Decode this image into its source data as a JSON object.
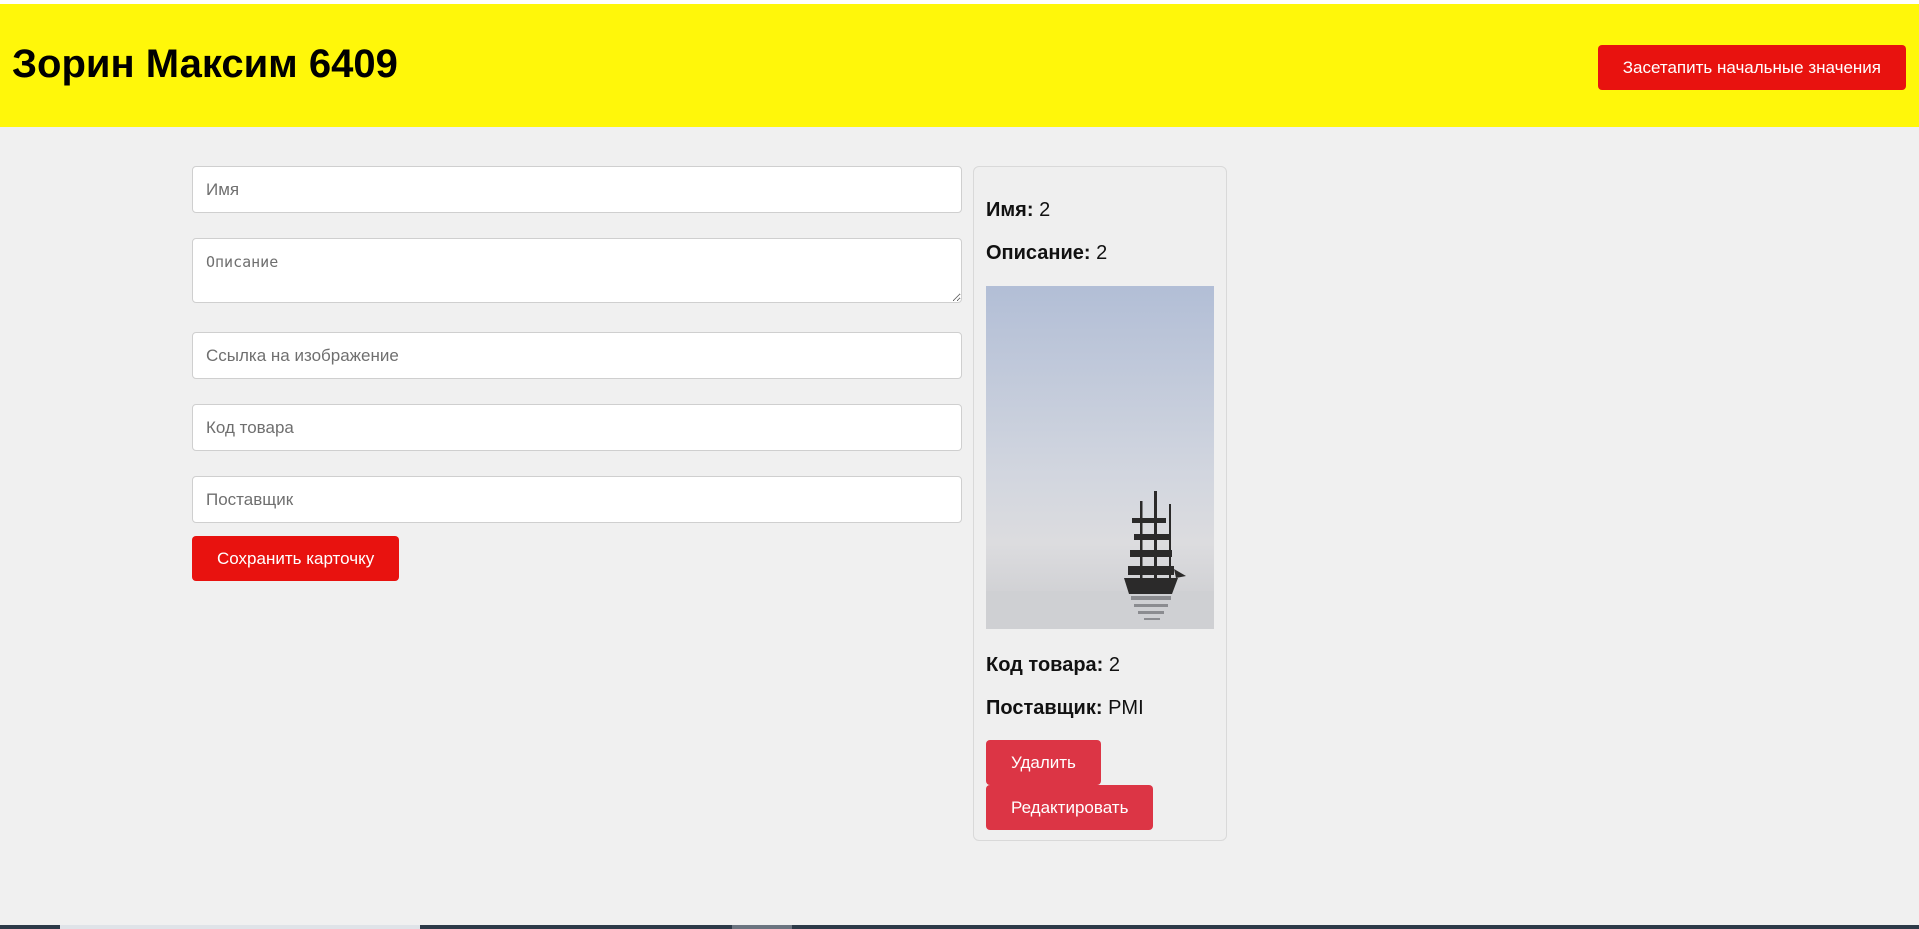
{
  "header": {
    "title": "Зорин Максим 6409",
    "reset_label": "Засетапить начальные значения"
  },
  "form": {
    "name_placeholder": "Имя",
    "description_placeholder": "Описание",
    "image_placeholder": "Ссылка на изображение",
    "code_placeholder": "Код товара",
    "supplier_placeholder": "Поставщик",
    "save_label": "Сохранить карточку"
  },
  "card": {
    "name_label": "Имя:",
    "name_value": "2",
    "description_label": "Описание:",
    "description_value": "2",
    "code_label": "Код товара:",
    "code_value": "2",
    "supplier_label": "Поставщик:",
    "supplier_value": "PMI",
    "delete_label": "Удалить",
    "edit_label": "Редактировать"
  },
  "colors": {
    "header_bg": "#fff70a",
    "primary_button": "#e8120f",
    "card_button": "#dc3545",
    "page_bg": "#f0f0f0"
  }
}
